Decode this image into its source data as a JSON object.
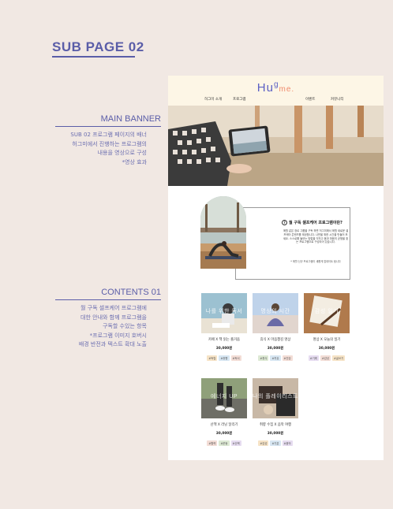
{
  "page": {
    "heading": "SUB PAGE 02"
  },
  "annotations": {
    "main_banner": {
      "title": "MAIN BANNER",
      "lines": [
        "SUB 02 프로그램 페이지의 배너",
        "허그미에서 진행하는 프로그램의",
        "내용을 영상으로 구성",
        "*영상 효과"
      ]
    },
    "contents01": {
      "title": "CONTENTS 01",
      "lines": [
        "월 구독 셀프케어 프로그램에",
        "대한 안내와 함께 프로그램을",
        "구독할 수있는 항목",
        "*프로그램 이미지 호버시",
        "배경 반전과 텍스트 확대 노출"
      ]
    }
  },
  "site": {
    "logo_main": "Hu",
    "logo_g": "g",
    "logo_me": "me.",
    "nav": [
      "허그미 소개",
      "프로그램",
      "이벤트",
      "커뮤니티"
    ],
    "intro": {
      "question": "월 구독 셀프케어 프로그램이란?",
      "body": "매월 같은 장르 그룹을 구독 하면 허그미에서 매월 새로운 셀프케어 콘텐츠를 제공합니다. 나만을 위한 시간을 만들어 보세요. 스스로를 돌보는 방법을 익히고 몸과 마음의 균형을 찾는 프로그램으로 구성되어 있습니다.",
      "note": "* 매월 신규 프로그램이 새롭게 업데이트 됩니다"
    },
    "cards": [
      {
        "overlay": "나를 위한 독서",
        "title": "카페 X 책 읽는 즐거움",
        "price": "30,000원",
        "tags": [
          "#독립",
          "#취향",
          "#독서"
        ]
      },
      {
        "overlay": "명상의 시간",
        "title": "휴식 X 마음챙김 명상",
        "price": "30,000원",
        "tags": [
          "#휴식",
          "#치유",
          "#건강"
        ]
      },
      {
        "overlay": "감성 일기",
        "title": "명상 X 오늘의 일기",
        "price": "30,000원",
        "tags": [
          "#기록",
          "#감성",
          "#글쓰기"
        ]
      },
      {
        "overlay": "에너지 UP",
        "title": "산책 X 러닝 달리기",
        "price": "30,000원",
        "tags": [
          "#활력",
          "#운동",
          "#산책"
        ]
      },
      {
        "overlay": "나의 플레이리스트",
        "title": "취향 수집 X 음악 여행",
        "price": "30,000원",
        "tags": [
          "#감성",
          "#기분",
          "#음악"
        ]
      }
    ]
  },
  "colors": {
    "brand": "#5b60c4",
    "accent": "#f08a6c",
    "annotation": "#5a5da8",
    "header_bg": "#fdf6e6"
  }
}
